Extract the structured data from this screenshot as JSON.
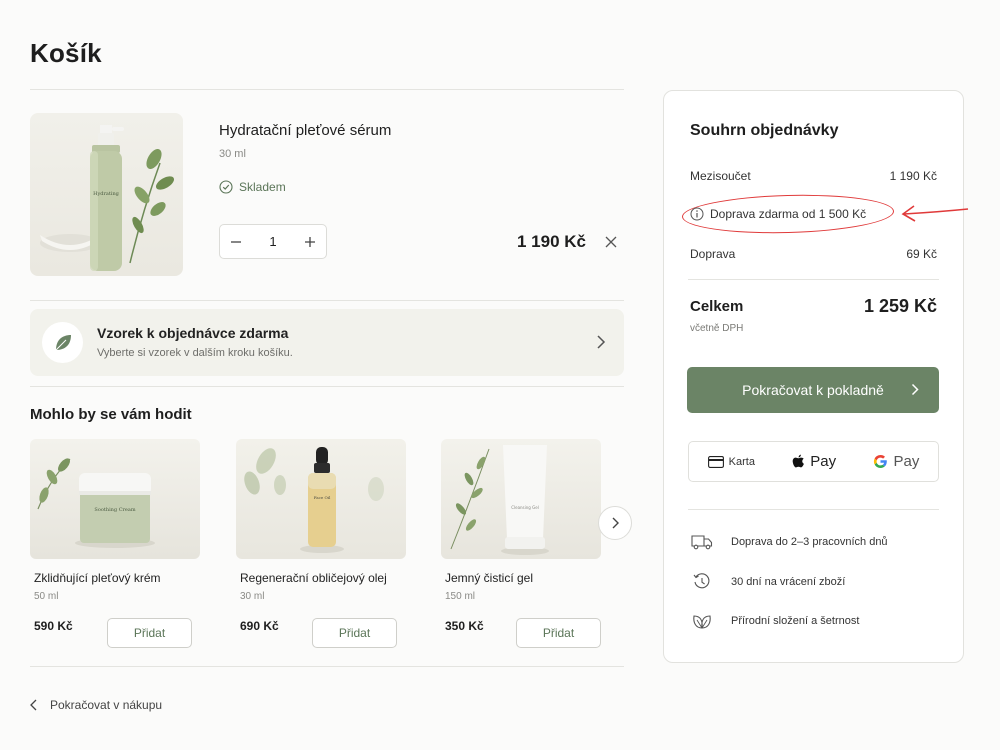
{
  "page": {
    "title": "Košík"
  },
  "cart": {
    "item": {
      "name": "Hydratační pleťové sérum",
      "volume": "30 ml",
      "stock": "Skladem",
      "quantity": "1",
      "price": "1 190 Kč",
      "bottle_label": "Hydrating"
    },
    "sample": {
      "title": "Vzorek k objednávce zdarma",
      "subtitle": "Vyberte si vzorek v dalším kroku košíku."
    }
  },
  "recommendations": {
    "title": "Mohlo by se vám hodit",
    "add_label": "Přidat",
    "items": [
      {
        "name": "Zklidňující pleťový krém",
        "volume": "50 ml",
        "price": "590 Kč",
        "jar_label": "Soothing Cream"
      },
      {
        "name": "Regenerační obličejový olej",
        "volume": "30 ml",
        "price": "690 Kč",
        "jar_label": "Face Oil"
      },
      {
        "name": "Jemný čisticí gel",
        "volume": "150 ml",
        "price": "350 Kč",
        "jar_label": "Cleansing Gel"
      }
    ]
  },
  "continue_shopping": "Pokračovat v nákupu",
  "summary": {
    "title": "Souhrn objednávky",
    "subtotal_label": "Mezisoučet",
    "subtotal_value": "1 190 Kč",
    "free_shipping_note": "Doprava zdarma od 1 500 Kč",
    "shipping_label": "Doprava",
    "shipping_value": "69 Kč",
    "total_label": "Celkem",
    "total_value": "1 259 Kč",
    "vat_note": "včetně DPH",
    "checkout_label": "Pokračovat k pokladně",
    "payment": {
      "card": "Karta",
      "apple": "Pay",
      "google": "Pay"
    },
    "benefits": [
      "Doprava do 2–3 pracovních dnů",
      "30 dní na vrácení zboží",
      "Přírodní složení a šetrnost"
    ]
  },
  "colors": {
    "accent": "#6b8466",
    "annotation": "#e03a3a",
    "text": "#1e1e1e"
  }
}
